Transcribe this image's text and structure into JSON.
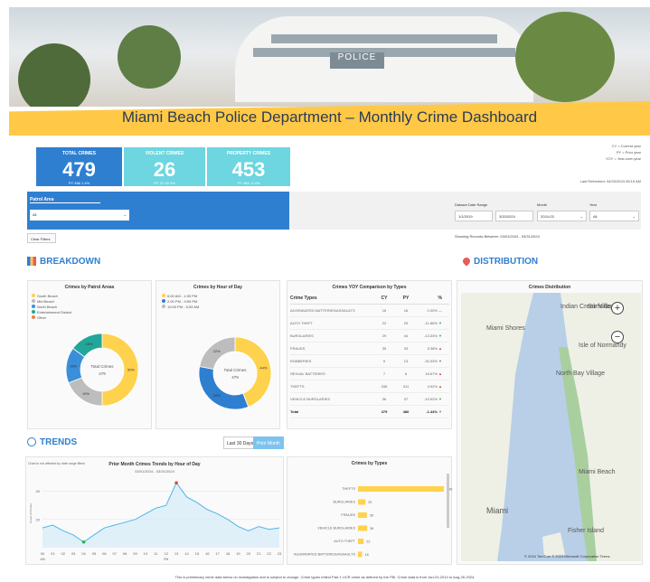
{
  "header": {
    "title": "Miami Beach Police Department – Monthly Crime Dashboard",
    "sign_text": "POLICE"
  },
  "kpis": [
    {
      "label": "TOTAL CRIMES",
      "value": "479",
      "sub": "PY 486  1.4%"
    },
    {
      "label": "VIOLENT CRIMES",
      "value": "26",
      "sub": "PY 22  18.2%"
    },
    {
      "label": "PROPERTY CRIMES",
      "value": "453",
      "sub": "PY 464  -2.4%"
    }
  ],
  "key_legend": [
    "CY = Current year",
    "PY = Prior year",
    "YOY = Year-over-year"
  ],
  "last_refreshed": "Last Refreshed: 04/20/2024 08:15 AM",
  "filters": {
    "patrol_area_label": "Patrol Area",
    "patrol_area_value": "All",
    "date_range_label": "Dataset Date Range",
    "date_from": "1/1/2019",
    "date_to": "3/20/2024",
    "month_label": "Month",
    "month_value": "2024-03",
    "year_label": "Year",
    "year_value": "All",
    "clear_label": "Clear Filters",
    "showing": "Showing Records Between:  03/01/2024 - 03/31/2024"
  },
  "sections": {
    "breakdown": "BREAKDOWN",
    "distribution": "DISTRIBUTION",
    "trends": "TRENDS"
  },
  "patrol_chart": {
    "title": "Crimes by Patrol Areas",
    "legend": [
      "South Beach",
      "Mid Beach",
      "North Beach",
      "Entertainment District",
      "Other"
    ],
    "center_label": "Total Crimes",
    "center_value": "479",
    "slices": [
      {
        "name": "South Beach",
        "value": 50,
        "color": "#ffd24d"
      },
      {
        "name": "Mid Beach",
        "value": 19,
        "color": "#bdbdbd"
      },
      {
        "name": "North Beach",
        "value": 16,
        "color": "#3b8fd9"
      },
      {
        "name": "Entertainment District",
        "value": 15,
        "color": "#23a69a"
      }
    ],
    "slice_labels": [
      "50%",
      "19%",
      "16%",
      "15%"
    ]
  },
  "hour_chart": {
    "title": "Crimes by Hour of Day",
    "legend": [
      "6:00 AM - 1:59 PM",
      "2:00 PM - 9:59 PM",
      "10:00 PM - 5:59 AM"
    ],
    "center_label": "Total Crimes",
    "center_value": "479",
    "slices": [
      {
        "name": "6:00 AM - 1:59 PM",
        "value": 44,
        "color": "#ffd24d"
      },
      {
        "name": "2:00 PM - 9:59 PM",
        "value": 34,
        "color": "#2f7fd1"
      },
      {
        "name": "10:00 PM - 5:59 AM",
        "value": 22,
        "color": "#bdbdbd"
      }
    ],
    "slice_labels": [
      "44%",
      "34%",
      "22%"
    ]
  },
  "yoy_table": {
    "title": "Crimes YOY Comparison by Types",
    "headers": [
      "Crime Types",
      "CY",
      "PY",
      "%"
    ],
    "rows": [
      [
        "AGGRAVATED BATTERIES/ASSAULTS",
        "16",
        "16",
        "0.00%",
        "flat"
      ],
      [
        "AUTO THEFT",
        "22",
        "25",
        "-11.86%",
        "down"
      ],
      [
        "BURGLARIES",
        "29",
        "44",
        "-13.33%",
        "down"
      ],
      [
        "FRAUDS",
        "35",
        "33",
        "5.38%",
        "up"
      ],
      [
        "ROBBERIES",
        "9",
        "13",
        "-30.33%",
        "down"
      ],
      [
        "SEXUAL BATTERIES",
        "7",
        "6",
        "16.67%",
        "up"
      ],
      [
        "THEFTS",
        "336",
        "311",
        "4.92%",
        "up"
      ],
      [
        "VEHICLE BURGLARIES",
        "36",
        "37",
        "-10.92%",
        "down"
      ]
    ],
    "total": [
      "Total",
      "479",
      "486",
      "-1.44%",
      "down"
    ]
  },
  "trend_buttons": {
    "last30": "Last 30 Days",
    "prior": "Prior Month"
  },
  "trend_chart": {
    "note": "Chart is not affected by date range filters",
    "title": "Prior Month Crimes Trends by Hour of Day",
    "subtitle": "03/01/2024 - 03/31/2024",
    "y_ticks": [
      "40",
      "20"
    ],
    "ylabel": "Count of Crimes",
    "x_ticks": [
      "00",
      "01",
      "02",
      "03",
      "04",
      "05",
      "06",
      "07",
      "08",
      "09",
      "10",
      "11",
      "12",
      "13",
      "14",
      "15",
      "16",
      "17",
      "18",
      "19",
      "20",
      "21",
      "22",
      "23"
    ],
    "x_sublabels": [
      "AM",
      "PM"
    ]
  },
  "chart_data": [
    {
      "type": "line",
      "title": "Prior Month Crimes Trends by Hour of Day",
      "x": [
        0,
        1,
        2,
        3,
        4,
        5,
        6,
        7,
        8,
        9,
        10,
        11,
        12,
        13,
        14,
        15,
        16,
        17,
        18,
        19,
        20,
        21,
        22,
        23
      ],
      "values": [
        14,
        16,
        12,
        9,
        4,
        9,
        14,
        16,
        18,
        20,
        24,
        28,
        30,
        46,
        36,
        32,
        27,
        24,
        20,
        15,
        12,
        15,
        13,
        14
      ],
      "ylim": [
        0,
        50
      ]
    },
    {
      "type": "bar",
      "title": "Crimes by Types",
      "categories": [
        "THEFTS",
        "BURGLARIES",
        "FRAUDS",
        "VEHICLE BURGLARIES",
        "AUTO THEFT",
        "AGGRAVATED BATTERIES/ASSAULTS"
      ],
      "values": [
        336,
        29,
        35,
        36,
        22,
        16
      ],
      "labels": [
        "336",
        "29",
        "35",
        "36",
        "22",
        "16"
      ],
      "color": "#ffd24d"
    }
  ],
  "distribution": {
    "title": "Crimes Distribution",
    "zoom_in": "+",
    "zoom_out": "−",
    "places": [
      "Indian Creek Village",
      "Surfside",
      "Miami Shores",
      "Isle of Normandy",
      "North Bay Village",
      "Miami Beach",
      "Miami",
      "Fisher Island"
    ],
    "attribution": "© 2024 TomTom © 2024 Microsoft Corporation  Terms"
  },
  "footer": "This is preliminary crime data below on investigation and is subject to change. Crime types reflect Part 1 UCR crime as defined by the FBI. Crime data is from Jan-01-2014 to Aug-26-2024."
}
